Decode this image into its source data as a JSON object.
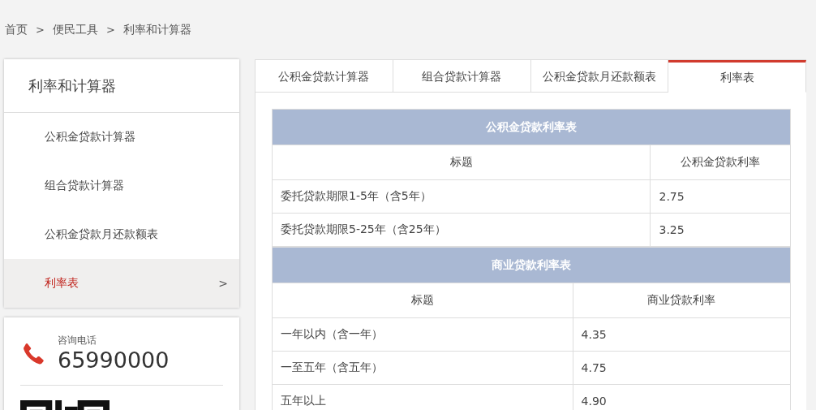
{
  "breadcrumb": [
    {
      "label": "首页",
      "separator": ">"
    },
    {
      "label": "便民工具",
      "separator": ">"
    },
    {
      "label": "利率和计算器"
    }
  ],
  "sidebar": {
    "title": "利率和计算器",
    "items": [
      {
        "label": "公积金贷款计算器",
        "selected": false
      },
      {
        "label": "组合贷款计算器",
        "selected": false
      },
      {
        "label": "公积金贷款月还款额表",
        "selected": false
      },
      {
        "label": "利率表",
        "selected": true,
        "arrow": ">"
      }
    ]
  },
  "contact": {
    "label": "咨询电话",
    "phone": "65990000"
  },
  "tabs": [
    {
      "label": "公积金贷款计算器",
      "selected": false
    },
    {
      "label": "组合贷款计算器",
      "selected": false
    },
    {
      "label": "公积金贷款月还款额表",
      "selected": false
    },
    {
      "label": "利率表",
      "selected": true
    }
  ],
  "tables": [
    {
      "title": "公积金贷款利率表",
      "columns": [
        "标题",
        "公积金贷款利率"
      ],
      "rows": [
        [
          "委托贷款期限1-5年（含5年）",
          "2.75"
        ],
        [
          "委托贷款期限5-25年（含25年）",
          "3.25"
        ]
      ]
    },
    {
      "title": "商业贷款利率表",
      "columns": [
        "标题",
        "商业贷款利率"
      ],
      "rows": [
        [
          "一年以内（含一年）",
          "4.35"
        ],
        [
          "一至五年（含五年）",
          "4.75"
        ],
        [
          "五年以上",
          "4.90"
        ]
      ]
    }
  ]
}
